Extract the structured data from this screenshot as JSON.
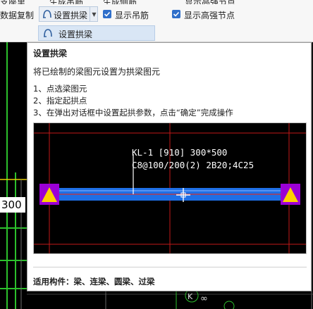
{
  "ribbon": {
    "item_data_copy": "数据复制",
    "set_arch_beam_button": "设置拱梁",
    "show_hanging_bar": "显示吊筋",
    "show_high_strength_node": "显示高强节点",
    "show_hanging_bar_checked": true,
    "show_high_strength_node_checked": true
  },
  "dropdown": {
    "item_label": "设置拱梁"
  },
  "cad": {
    "left_dimension": "300"
  },
  "tooltip": {
    "title": "设置拱梁",
    "description": "将已绘制的梁图元设置为拱梁图元",
    "steps": [
      "1、点选梁图元",
      "2、指定起拱点",
      "3、在弹出对话框中设置起拱参数，点击“确定”完成操作"
    ],
    "preview": {
      "beam_label_line1": "KL-1 [910] 300*500",
      "beam_label_line2": "C8@100/200(2) 2B20;4C25"
    },
    "footer_label": "适用构件：",
    "footer_value": "梁、连梁、圆梁、过梁"
  },
  "colors": {
    "beam_fill": "#1e6fe6",
    "grid_red": "#c21818",
    "support_purple": "#9b00d6",
    "support_yellow": "#ffd000",
    "cad_green": "#2cc02c"
  }
}
